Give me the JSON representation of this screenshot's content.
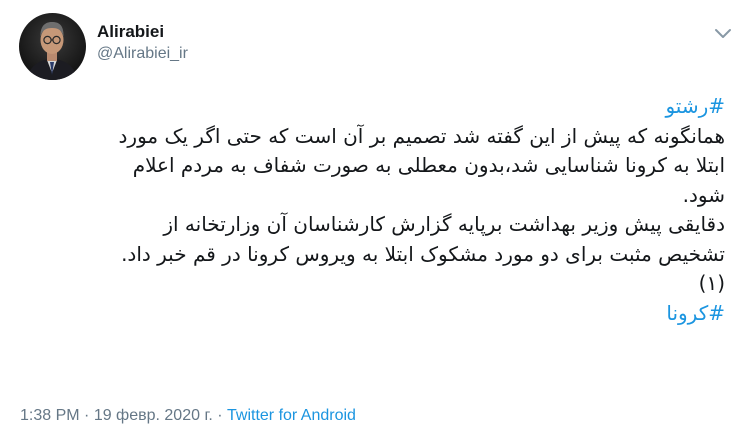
{
  "author": {
    "display_name": "Alirabiei",
    "handle": "@Alirabiei_ir"
  },
  "tweet": {
    "hashtag_top": "#رشتو",
    "lines": [
      "همانگونه که پیش از این گفته شد تصمیم بر آن است که حتی اگر یک مورد",
      "ابتلا به کرونا شناسایی شد،بدون معطلی به صورت شفاف به مردم اعلام",
      "شود.",
      " دقایقی پیش وزیر بهداشت برپایه گزارش کارشناسان آن وزارتخانه از",
      "تشخیص مثبت برای دو مورد مشکوک ابتلا به ویروس کرونا در قم خبر داد.",
      "(۱)"
    ],
    "hashtag_bottom": "#کرونا"
  },
  "footer": {
    "time": "1:38 PM",
    "separator": " · ",
    "date": "19 февр. 2020 г.",
    "source": "Twitter for Android"
  },
  "icons": {
    "menu": "chevron-down-icon",
    "avatar": "avatar"
  },
  "colors": {
    "link": "#1b95e0",
    "muted": "#657786",
    "text": "#14171a"
  }
}
